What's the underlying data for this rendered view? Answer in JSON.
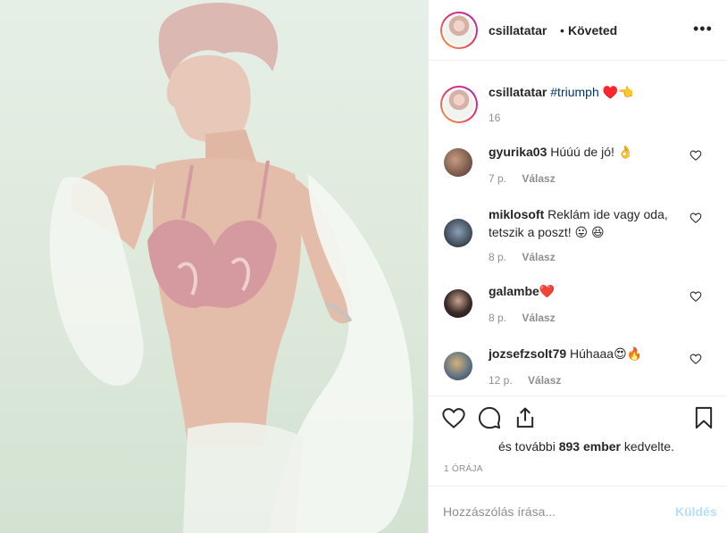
{
  "post": {
    "username": "csillatatar",
    "separator": "•",
    "follow_status": "Követed",
    "more_icon": "more-options-icon",
    "caption": {
      "username": "csillatatar",
      "hashtag": "#triumph",
      "emoji": "♥️👈",
      "time": "16"
    }
  },
  "comments": [
    {
      "user": "gyurika03",
      "text": "Húúú de jó! 👌",
      "time": "7 p.",
      "reply": "Válasz"
    },
    {
      "user": "miklosoft",
      "text": "Reklám ide vagy oda, tetszik a poszt! 😛 😆",
      "time": "8 p.",
      "reply": "Válasz"
    },
    {
      "user": "galambe",
      "text": "❤️",
      "time": "8 p.",
      "reply": "Válasz"
    },
    {
      "user": "jozsefzsolt79",
      "text": "Húhaaa😍🔥",
      "time": "12 p.",
      "reply": "Válasz"
    }
  ],
  "actions": {
    "likes_prefix": "és további ",
    "likes_count": "893 ember",
    "likes_suffix": " kedvelte.",
    "age": "1 ÓRÁJA"
  },
  "composer": {
    "placeholder": "Hozzászólás írása...",
    "send_label": "Küldés"
  },
  "colors": {
    "link": "#00376b",
    "muted": "#8e8e8e",
    "send_disabled": "#b2dffc"
  }
}
